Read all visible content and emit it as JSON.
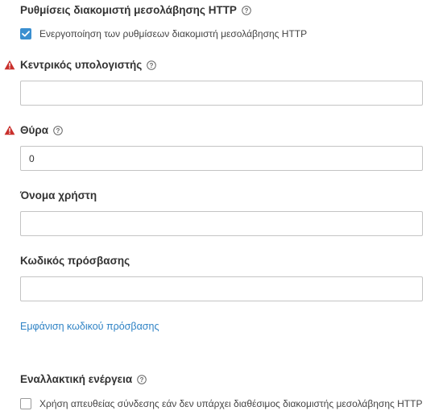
{
  "proxy_section": {
    "title": "Ρυθμίσεις διακομιστή μεσολάβησης HTTP",
    "enable_checkbox": {
      "label": "Ενεργοποίηση των ρυθμίσεων διακομιστή μεσολάβησης HTTP",
      "checked": true
    }
  },
  "host_field": {
    "label": "Κεντρικός υπολογιστής",
    "value": "",
    "has_warning": true
  },
  "port_field": {
    "label": "Θύρα",
    "value": "0",
    "has_warning": true
  },
  "username_field": {
    "label": "Όνομα χρήστη",
    "value": ""
  },
  "password_field": {
    "label": "Κωδικός πρόσβασης",
    "value": ""
  },
  "show_password_link": "Εμφάνιση κωδικού πρόσβασης",
  "fallback_section": {
    "title": "Εναλλακτική ενέργεια",
    "direct_checkbox": {
      "label": "Χρήση απευθείας σύνδεσης εάν δεν υπάρχει διαθέσιμος διακομιστής μεσολάβησης HTTP",
      "checked": false
    }
  },
  "colors": {
    "accent": "#3a8fd0",
    "link": "#2f83c5",
    "warning": "#c9302c"
  }
}
